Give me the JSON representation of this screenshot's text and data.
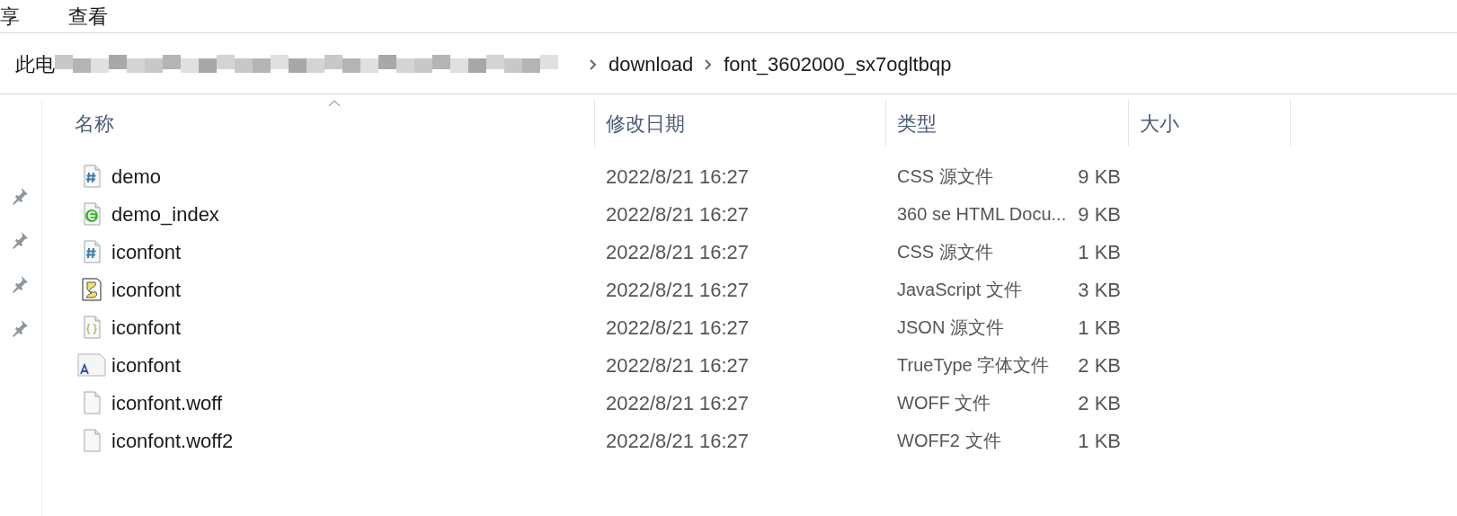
{
  "menu": [
    {
      "label": "享"
    },
    {
      "label": "查看"
    }
  ],
  "breadcrumb": {
    "start": "此电",
    "redacted": true,
    "segments": [
      "download",
      "font_3602000_sx7ogltbqp"
    ]
  },
  "table": {
    "columns": [
      "名称",
      "修改日期",
      "类型",
      "大小"
    ],
    "rows": [
      {
        "kind": "css",
        "name": "demo",
        "date": "2022/8/21 16:27",
        "type": "CSS 源文件",
        "size": "9 KB"
      },
      {
        "kind": "html",
        "name": "demo_index",
        "date": "2022/8/21 16:27",
        "type": "360 se HTML Docu...",
        "size": "9 KB"
      },
      {
        "kind": "css",
        "name": "iconfont",
        "date": "2022/8/21 16:27",
        "type": "CSS 源文件",
        "size": "1 KB"
      },
      {
        "kind": "js",
        "name": "iconfont",
        "date": "2022/8/21 16:27",
        "type": "JavaScript 文件",
        "size": "3 KB"
      },
      {
        "kind": "json",
        "name": "iconfont",
        "date": "2022/8/21 16:27",
        "type": "JSON 源文件",
        "size": "1 KB"
      },
      {
        "kind": "ttf",
        "name": "iconfont",
        "date": "2022/8/21 16:27",
        "type": "TrueType 字体文件",
        "size": "2 KB"
      },
      {
        "kind": "blank",
        "name": "iconfont.woff",
        "date": "2022/8/21 16:27",
        "type": "WOFF 文件",
        "size": "2 KB"
      },
      {
        "kind": "blank",
        "name": "iconfont.woff2",
        "date": "2022/8/21 16:27",
        "type": "WOFF2 文件",
        "size": "1 KB"
      }
    ]
  }
}
